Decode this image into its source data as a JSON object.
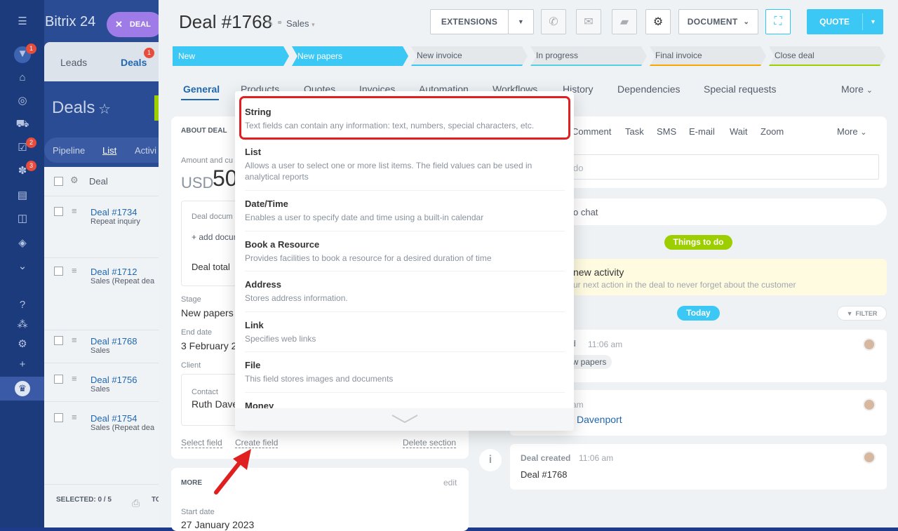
{
  "app": {
    "brand": "Bitrix 24",
    "deal_chip": "DEAL"
  },
  "rail_badges": [
    "1",
    "2",
    "3"
  ],
  "bg_panel": {
    "tabs": [
      "Leads",
      "Deals"
    ],
    "deals_badge": "1",
    "title": "Deals",
    "views": [
      "Pipeline",
      "List",
      "Activi"
    ],
    "column_header": "Deal",
    "rows": [
      {
        "name": "Deal #1734",
        "sub": "Repeat inquiry"
      },
      {
        "name": "Deal #1712",
        "sub": "Sales (Repeat dea"
      },
      {
        "name": "Deal #1768",
        "sub": "Sales"
      },
      {
        "name": "Deal #1756",
        "sub": "Sales"
      },
      {
        "name": "Deal #1754",
        "sub": "Sales (Repeat dea"
      }
    ],
    "selected": "SELECTED: 0 / 5",
    "footer_right": "TO"
  },
  "header": {
    "title": "Deal #1768",
    "pipeline": "Sales",
    "extensions": "EXTENSIONS",
    "document": "DOCUMENT",
    "quote": "QUOTE"
  },
  "stages": [
    "New",
    "New papers",
    "New invoice",
    "In progress",
    "Final invoice",
    "Close deal"
  ],
  "tabs": [
    "General",
    "Products",
    "Quotes",
    "Invoices",
    "Automation",
    "Workflows",
    "History",
    "Dependencies",
    "Special requests",
    "More"
  ],
  "about": {
    "section_title": "ABOUT DEAL",
    "amount_label": "Amount and cu",
    "currency": "USD",
    "amount": "50",
    "doc_label": "Deal docum",
    "add_doc": "+ add docum",
    "deal_total": "Deal total",
    "stage_label": "Stage",
    "stage_value": "New papers",
    "end_label": "End date",
    "end_value": "3 February 2",
    "client_label": "Client",
    "contact_label": "Contact",
    "contact_value": "Ruth Dave",
    "select_field": "Select field",
    "create_field": "Create field",
    "delete_section": "Delete section"
  },
  "more": {
    "title": "MORE",
    "edit": "edit",
    "start_label": "Start date",
    "start_value": "27 January 2023"
  },
  "timeline": {
    "actions": [
      "Comment",
      "Task",
      "SMS",
      "E-mail",
      "Wait",
      "Zoom",
      "More"
    ],
    "todo_placeholder": "do",
    "chat": "o chat",
    "things_badge": "Things to do",
    "activity_title": "new activity",
    "activity_desc": "ur next action in the deal to never forget about the customer",
    "today": "Today",
    "filter": "FILTER",
    "e1_title": "ed",
    "e1_time": "11:06 am",
    "e1_tag": "ew papers",
    "e2_time": "6 am",
    "e2_link": "Davenport",
    "e3_title": "Deal created",
    "e3_time": "11:06 am",
    "e3_body": "Deal #1768"
  },
  "field_types": [
    {
      "title": "String",
      "desc": "Text fields can contain any information: text, numbers, special characters, etc."
    },
    {
      "title": "List",
      "desc": "Allows a user to select one or more list items. The field values can be used in analytical reports"
    },
    {
      "title": "Date/Time",
      "desc": "Enables a user to specify date and time using a built-in calendar"
    },
    {
      "title": "Book a Resource",
      "desc": "Provides facilities to book a resource for a desired duration of time"
    },
    {
      "title": "Address",
      "desc": "Stores address information."
    },
    {
      "title": "Link",
      "desc": "Specifies web links"
    },
    {
      "title": "File",
      "desc": "This field stores images and documents"
    },
    {
      "title": "Money",
      "desc": ""
    }
  ],
  "colors": {
    "accent": "#3bc8f5",
    "highlight": "#e02020",
    "green": "#9dcf00"
  }
}
